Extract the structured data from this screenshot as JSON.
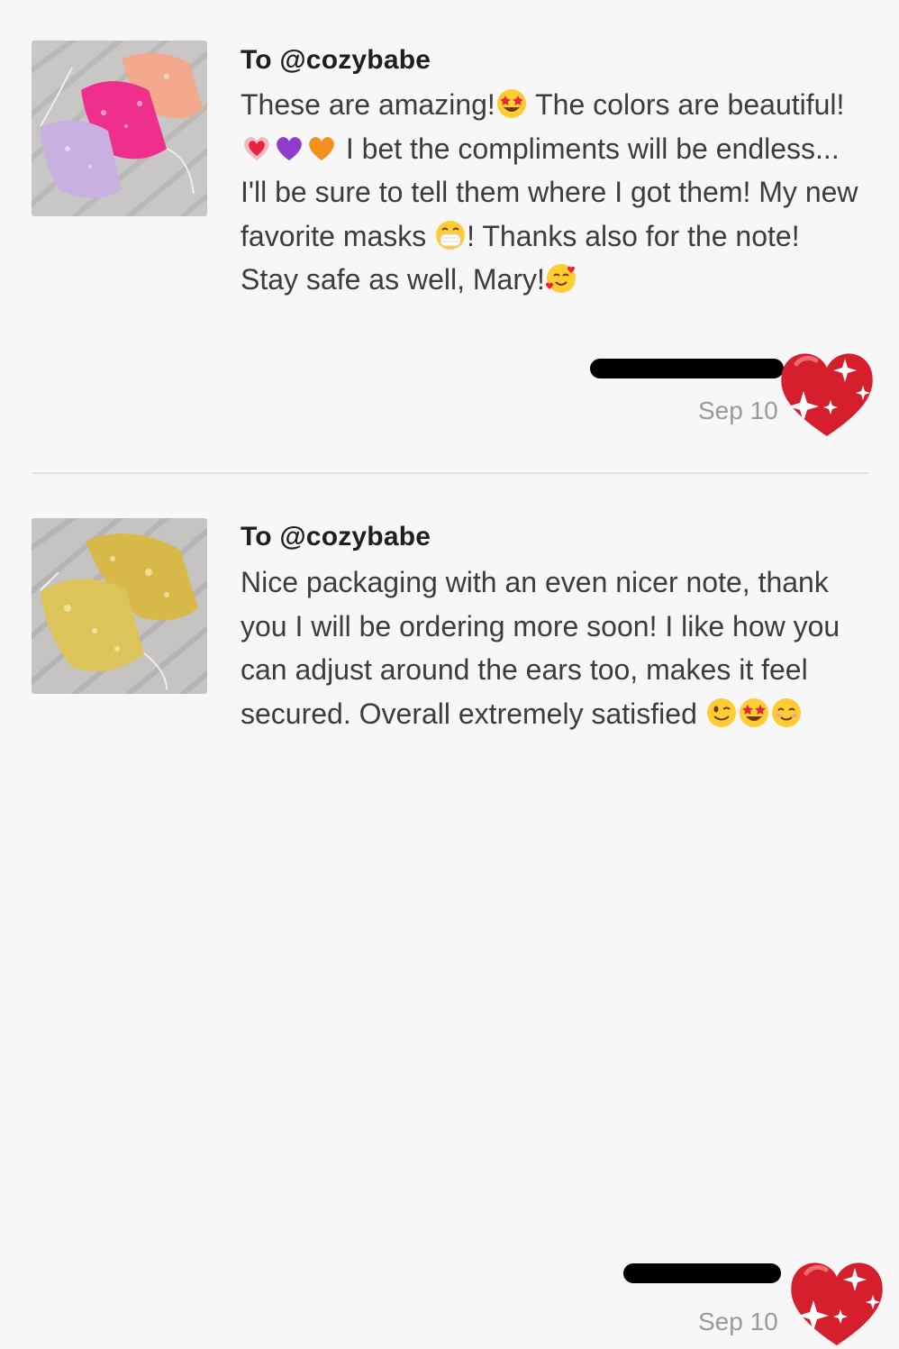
{
  "reviews": [
    {
      "recipient": "To @cozybabe",
      "image_alt": "pink, peach and lavender sequin face masks",
      "text_parts": [
        "These are amazing!",
        " The colors are beautiful!",
        " I bet the compliments will be endless... I'll be sure to tell them where I got them! My new favorite masks ",
        "! Thanks also for the note! Stay safe as well, Mary!"
      ],
      "emojis": [
        "star-struck-icon",
        "heart-with-ribbon-icon",
        "purple-heart-icon",
        "orange-heart-icon",
        "face-with-mask-icon",
        "smiling-face-with-hearts-icon"
      ],
      "date": "Sep 10",
      "reaction": "sparkling-heart-icon"
    },
    {
      "recipient": "To @cozybabe",
      "image_alt": "gold sequin face masks",
      "text_parts": [
        "Nice packaging with an even nicer note, thank you I will be ordering more soon! I like how you can adjust around the ears too, makes it feel secured. Overall extremely satisfied "
      ],
      "emojis": [
        "winking-face-icon",
        "star-struck-icon",
        "smiling-face-icon"
      ],
      "date": "Sep 10",
      "reaction": "sparkling-heart-icon"
    }
  ],
  "colors": {
    "background": "#f7f7f7",
    "text": "#3c3c3c",
    "recipient": "#1f1f1f",
    "date": "#9a9a9a",
    "heart": "#d61f2c"
  }
}
